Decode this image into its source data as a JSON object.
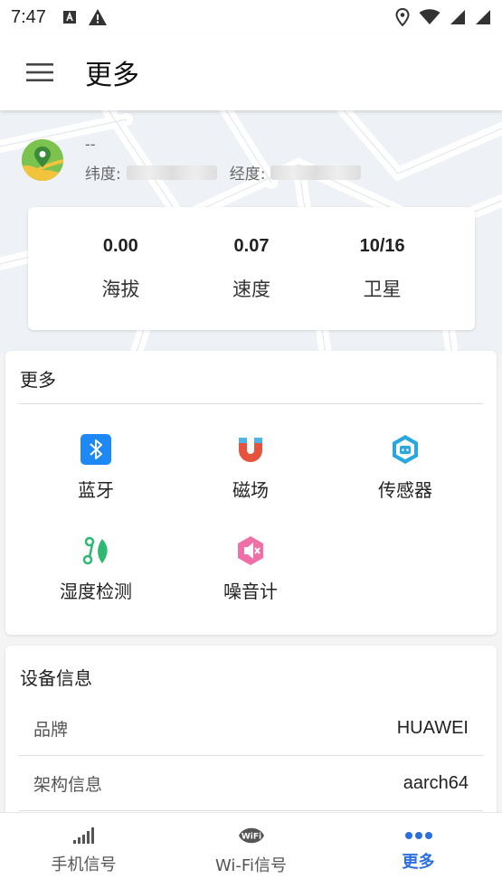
{
  "status_bar": {
    "time": "7:47",
    "left_icons": [
      "a-box-icon",
      "warning-icon"
    ],
    "right_icons": [
      "location-icon",
      "wifi-icon",
      "signal-icon",
      "signal-icon"
    ]
  },
  "app_bar": {
    "title": "更多",
    "menu_icon": "menu-icon"
  },
  "location": {
    "name": "--",
    "latitude_label": "纬度:",
    "longitude_label": "经度:"
  },
  "stats": [
    {
      "value": "0.00",
      "label": "海拔"
    },
    {
      "value": "0.07",
      "label": "速度"
    },
    {
      "value": "10/16",
      "label": "卫星"
    }
  ],
  "more": {
    "title": "更多",
    "tools": [
      {
        "label": "蓝牙",
        "icon": "bluetooth-icon",
        "color": "#1e88f5"
      },
      {
        "label": "磁场",
        "icon": "magnet-icon",
        "color": "#e5533d"
      },
      {
        "label": "传感器",
        "icon": "sensor-icon",
        "color": "#2aa6e0"
      },
      {
        "label": "湿度检测",
        "icon": "humidity-icon",
        "color": "#2eb872"
      },
      {
        "label": "噪音计",
        "icon": "noise-icon",
        "color": "#ef6fa8"
      }
    ]
  },
  "device_info": {
    "title": "设备信息",
    "rows": [
      {
        "key": "品牌",
        "value": "HUAWEI"
      },
      {
        "key": "架构信息",
        "value": "aarch64"
      }
    ]
  },
  "bottom_nav": {
    "items": [
      {
        "label": "手机信号",
        "icon": "cell-signal-icon"
      },
      {
        "label": "Wi-Fi信号",
        "icon": "wifi-badge-icon"
      },
      {
        "label": "更多",
        "icon": "more-dots-icon"
      }
    ],
    "active_color": "#2c6fe0"
  }
}
